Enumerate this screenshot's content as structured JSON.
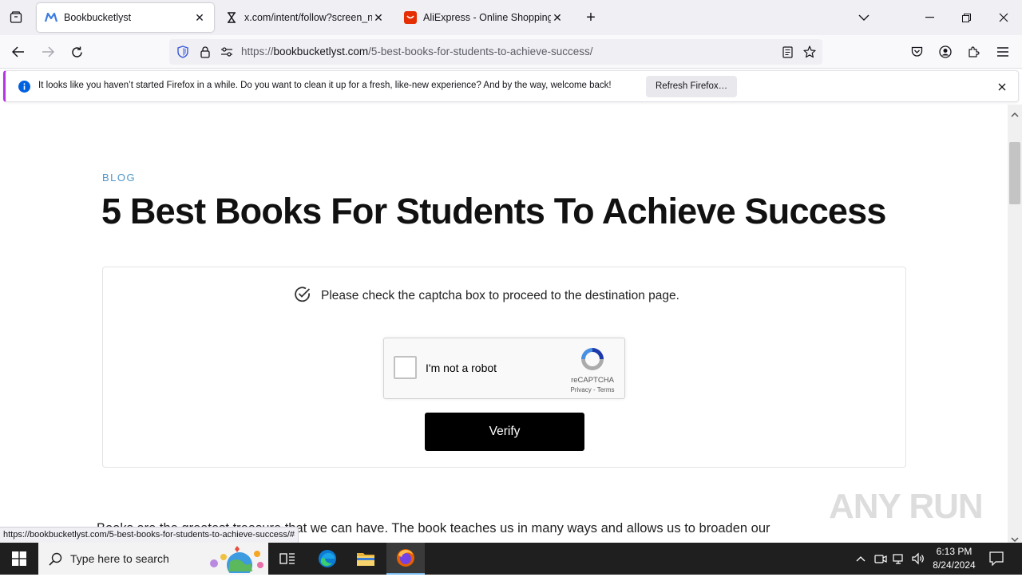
{
  "browser": {
    "tabs": [
      {
        "title": "Bookbucketlyst",
        "active": true,
        "icon": "bookbucketlyst-favicon"
      },
      {
        "title": "x.com/intent/follow?screen_na",
        "active": false,
        "icon": "hourglass-icon"
      },
      {
        "title": "AliExpress - Online Shopping fo",
        "active": false,
        "icon": "aliexpress-favicon"
      }
    ],
    "url_prefix": "https://",
    "url_host": "bookbucketlyst.com",
    "url_path": "/5-best-books-for-students-to-achieve-success/",
    "notification": {
      "text": "It looks like you haven’t started Firefox in a while. Do you want to clean it up for a fresh, like-new experience? And by the way, welcome back!",
      "button": "Refresh Firefox…"
    },
    "status_url": "https://bookbucketlyst.com/5-best-books-for-students-to-achieve-success/#"
  },
  "page": {
    "category": "BLOG",
    "title": "5 Best Books For Students To Achieve Success",
    "captcha_message": "Please check the captcha box to proceed to the destination page.",
    "recaptcha": {
      "label": "I'm not a robot",
      "brand": "reCAPTCHA",
      "links": "Privacy - Terms"
    },
    "verify_label": "Verify",
    "body_text": "Books are the greatest treasure that we can have. The book teaches us in many ways and allows us to broaden our",
    "watermark": "ANY RUN"
  },
  "taskbar": {
    "search_placeholder": "Type here to search",
    "time": "6:13 PM",
    "date": "8/24/2024"
  },
  "colors": {
    "accent_blue": "#4d97c9",
    "firefox_notification_accent": "#b833e1",
    "verify_button": "#000000"
  }
}
